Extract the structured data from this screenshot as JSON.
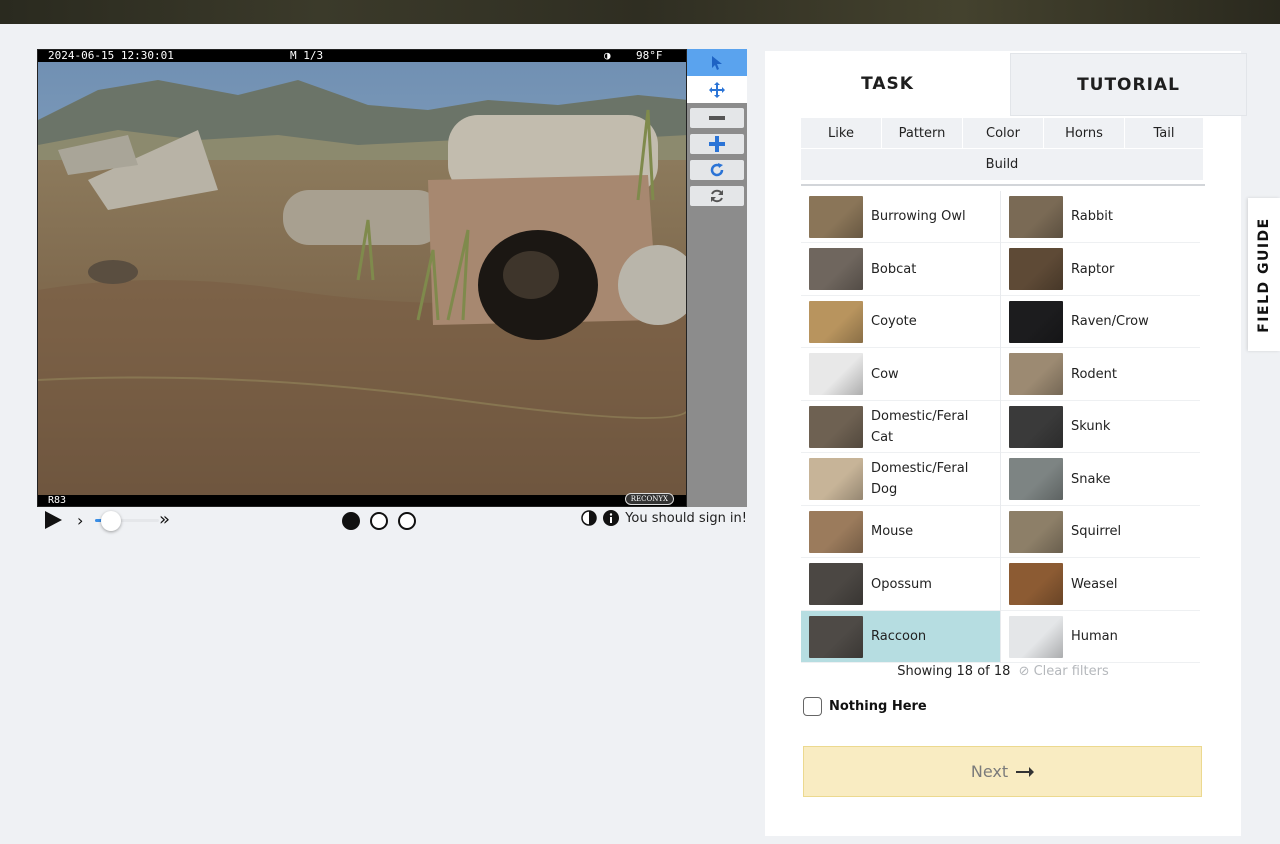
{
  "camera": {
    "timestamp": "2024-06-15 12:30:01",
    "frame_marker": "M 1/3",
    "temperature": "98°F",
    "camera_id": "R83",
    "logo_text": "RECONYX"
  },
  "toolbar": {
    "tools": [
      "pointer-icon",
      "move-icon",
      "zoom-out-icon",
      "zoom-in-icon",
      "rotate-icon",
      "reset-icon"
    ]
  },
  "playback": {
    "play_icon": "play-icon",
    "progress": 0.25,
    "frames_total": 3,
    "current_frame": 1
  },
  "meta": {
    "sign_in_text": "You should sign in!"
  },
  "tabs": {
    "task": "TASK",
    "tutorial": "TUTORIAL"
  },
  "filters": {
    "row1": [
      "Like",
      "Pattern",
      "Color",
      "Horns",
      "Tail"
    ],
    "row2": [
      "Build"
    ]
  },
  "choices": [
    {
      "label": "Burrowing Owl",
      "color": "#8a7558"
    },
    {
      "label": "Rabbit",
      "color": "#7a6a55"
    },
    {
      "label": "Bobcat",
      "color": "#6f665e"
    },
    {
      "label": "Raptor",
      "color": "#5e4a36"
    },
    {
      "label": "Coyote",
      "color": "#b8945e"
    },
    {
      "label": "Raven/Crow",
      "color": "#1c1c1e"
    },
    {
      "label": "Cow",
      "color": "#e8e8e8"
    },
    {
      "label": "Rodent",
      "color": "#9c8a72"
    },
    {
      "label": "Domestic/Feral Cat",
      "color": "#6e6152"
    },
    {
      "label": "Skunk",
      "color": "#3a3a3a"
    },
    {
      "label": "Domestic/Feral Dog",
      "color": "#c7b498"
    },
    {
      "label": "Snake",
      "color": "#7d8483"
    },
    {
      "label": "Mouse",
      "color": "#9b7b5c"
    },
    {
      "label": "Squirrel",
      "color": "#8d7f68"
    },
    {
      "label": "Opossum",
      "color": "#4b4743"
    },
    {
      "label": "Weasel",
      "color": "#8c5b33"
    },
    {
      "label": "Raccoon",
      "color": "#4e4a46",
      "selected": true
    },
    {
      "label": "Human",
      "color": "#e4e6e8"
    }
  ],
  "showing": {
    "count_text": "Showing 18 of 18",
    "clear_text": "Clear filters"
  },
  "nothing_here": "Nothing Here",
  "next_label": "Next",
  "field_guide": "FIELD GUIDE",
  "colors": {
    "selected": "#b6dde1",
    "next_bg": "#f9ecc2",
    "accent": "#3a8ee6"
  }
}
